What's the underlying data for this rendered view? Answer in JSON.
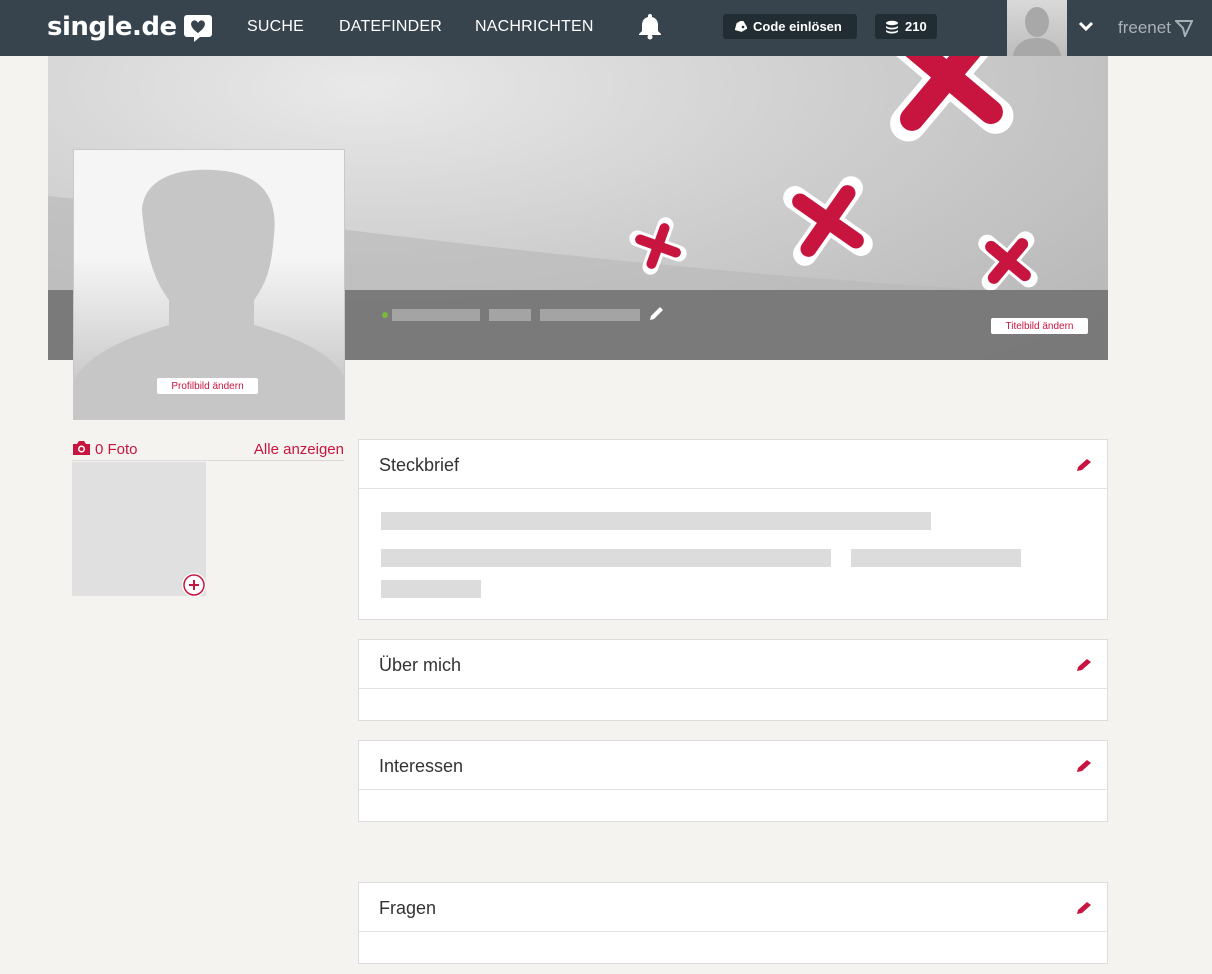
{
  "nav": {
    "logo_text": "single.de",
    "items": [
      {
        "label": "SUCHE"
      },
      {
        "label": "DATEFINDER"
      },
      {
        "label": "NACHRICHTEN"
      }
    ],
    "code_label": "Code einlösen",
    "coins": "210",
    "brand_partner": "freenet"
  },
  "cover": {
    "change_cover_label": "Titelbild ändern"
  },
  "profile": {
    "change_picture_label": "Profilbild ändern"
  },
  "photos": {
    "count_label": "0 Foto",
    "show_all_label": "Alle anzeigen"
  },
  "sections": [
    {
      "title": "Steckbrief"
    },
    {
      "title": "Über mich"
    },
    {
      "title": "Interessen"
    },
    {
      "title": "Fragen"
    }
  ],
  "colors": {
    "accent": "#c8153f",
    "topbar": "#37444d",
    "background": "#f4f3ef"
  }
}
